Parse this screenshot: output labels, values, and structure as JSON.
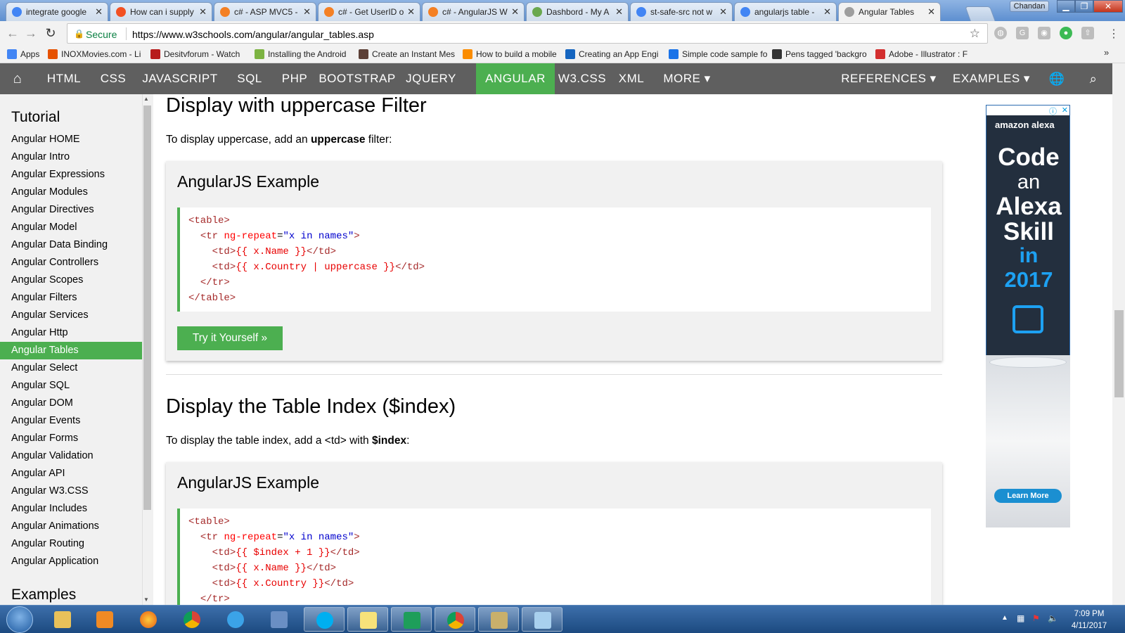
{
  "browser": {
    "tabs": [
      {
        "label": "integrate google",
        "icon": "google-icon"
      },
      {
        "label": "How can i supply",
        "icon": "microsoft-icon"
      },
      {
        "label": "c# - ASP MVC5 -",
        "icon": "stackoverflow-icon"
      },
      {
        "label": "c# - Get UserID o",
        "icon": "stackoverflow-icon"
      },
      {
        "label": "c# - AngularJS W",
        "icon": "stackoverflow-icon"
      },
      {
        "label": "Dashbord - My A",
        "icon": "dashboard-icon"
      },
      {
        "label": "st-safe-src not w",
        "icon": "google-icon"
      },
      {
        "label": "angularjs table -",
        "icon": "google-icon"
      },
      {
        "label": "Angular Tables",
        "icon": "page-icon",
        "active": true
      }
    ],
    "profile_name": "Chandan",
    "secure_label": "Secure",
    "url": "https://www.w3schools.com/angular/angular_tables.asp",
    "bookmarks": [
      {
        "label": "Apps",
        "icon": "apps-icon"
      },
      {
        "label": "INOXMovies.com - Li",
        "icon": "inox-icon"
      },
      {
        "label": "Desitvforum - Watch",
        "icon": "desitv-icon"
      },
      {
        "label": "Installing the Android",
        "icon": "android-icon"
      },
      {
        "label": "Create an Instant Mes",
        "icon": "bookmark-icon"
      },
      {
        "label": "How to build a mobile",
        "icon": "chrome-icon"
      },
      {
        "label": "Creating an App Engi",
        "icon": "appengine-icon"
      },
      {
        "label": "Simple code sample fo",
        "icon": "grid-icon"
      },
      {
        "label": "Pens tagged 'backgro",
        "icon": "codepen-icon"
      },
      {
        "label": "Adobe - Illustrator : F",
        "icon": "adobe-icon"
      }
    ]
  },
  "nav": {
    "items": [
      "HTML",
      "CSS",
      "JAVASCRIPT",
      "SQL",
      "PHP",
      "BOOTSTRAP",
      "JQUERY",
      "ANGULAR",
      "W3.CSS",
      "XML",
      "MORE ▾"
    ],
    "right": [
      "REFERENCES ▾",
      "EXAMPLES ▾"
    ],
    "active": "ANGULAR"
  },
  "sidebar": {
    "heading": "Tutorial",
    "items": [
      "Angular HOME",
      "Angular Intro",
      "Angular Expressions",
      "Angular Modules",
      "Angular Directives",
      "Angular Model",
      "Angular Data Binding",
      "Angular Controllers",
      "Angular Scopes",
      "Angular Filters",
      "Angular Services",
      "Angular Http",
      "Angular Tables",
      "Angular Select",
      "Angular SQL",
      "Angular DOM",
      "Angular Events",
      "Angular Forms",
      "Angular Validation",
      "Angular API",
      "Angular W3.CSS",
      "Angular Includes",
      "Angular Animations",
      "Angular Routing",
      "Angular Application"
    ],
    "active": "Angular Tables",
    "heading2": "Examples"
  },
  "main": {
    "section1": {
      "title": "Display with uppercase Filter",
      "text_before": "To display uppercase, add an ",
      "text_bold": "uppercase",
      "text_after": " filter:",
      "card_title": "AngularJS Example",
      "try_label": "Try it Yourself »"
    },
    "section2": {
      "title": "Display the Table Index ($index)",
      "text_before": "To display the table index, add a <td> with ",
      "text_bold": "$index",
      "text_after": ":",
      "card_title": "AngularJS Example"
    }
  },
  "ad": {
    "brand": "amazon alexa",
    "line1": "Code",
    "line2": "an",
    "line3": "Alexa",
    "line4": "Skill",
    "line5": "in",
    "line6": "2017",
    "cta": "Learn More"
  },
  "taskbar": {
    "time": "7:09 PM",
    "date": "4/11/2017"
  }
}
